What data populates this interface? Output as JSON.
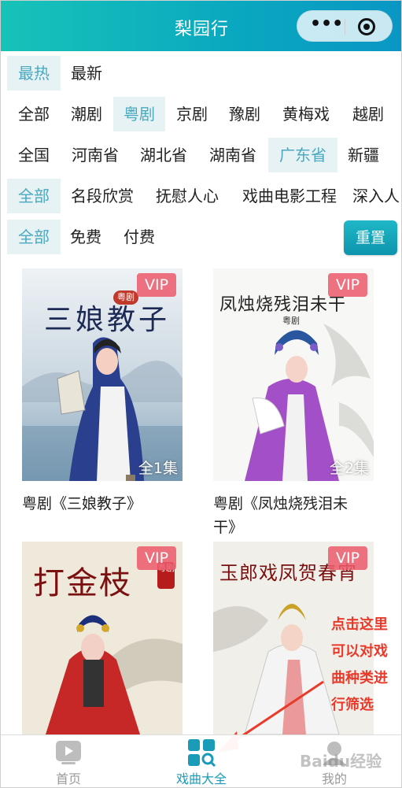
{
  "header": {
    "title": "梨园行"
  },
  "filters": {
    "sort": [
      "最热",
      "最新"
    ],
    "genres": [
      "全部",
      "潮剧",
      "粤剧",
      "京剧",
      "豫剧",
      "黄梅戏",
      "越剧"
    ],
    "regions": [
      "全国",
      "河南省",
      "湖北省",
      "湖南省",
      "广东省",
      "新疆"
    ],
    "categories": [
      "全部",
      "名段欣赏",
      "抚慰人心",
      "戏曲电影工程",
      "深入人"
    ],
    "price": [
      "全部",
      "免费",
      "付费"
    ],
    "reset_label": "重置"
  },
  "cards": [
    {
      "title": "粤剧《三娘教子》",
      "vip": "VIP",
      "episodes": "全1集",
      "poster_text": "三娘教子",
      "poster_tag": "粤剧"
    },
    {
      "title_line1": "粤剧《凤烛烧残泪未",
      "title_line2": "干》",
      "vip": "VIP",
      "episodes": "全2集",
      "poster_text": "凤烛烧残泪未干",
      "poster_tag": "粤剧"
    },
    {
      "vip": "VIP",
      "poster_text": "打金枝",
      "poster_tag": "粤剧"
    },
    {
      "vip": "VIP",
      "poster_text": "玉郎戏凤贺春宵"
    }
  ],
  "annotation": [
    "点击这里",
    "可以对戏",
    "曲种类进",
    "行筛选"
  ],
  "tabbar": {
    "home": "首页",
    "catalog": "戏曲大全",
    "mine": "我的"
  },
  "watermark": "Baidu经验",
  "colors": {
    "accent": "#1a9cb8",
    "active_chip_bg": "#e6f2f4",
    "vip": "#ec596b",
    "annotation": "#e83a2a"
  }
}
